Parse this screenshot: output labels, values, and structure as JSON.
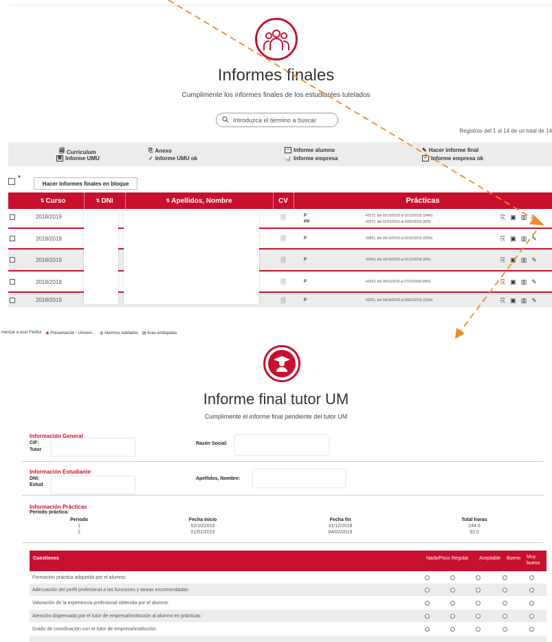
{
  "top": {
    "title": "Informes finales",
    "subtitle": "Cumplimente los informes finales de los estudiantes tutelados",
    "search_placeholder": "Introduzca el término a buscar",
    "records": "Registros del 1 al 14 de un total de 14"
  },
  "legend": {
    "curriculum": "Curriculum",
    "informe_umu": "Informe UMU",
    "anexo": "Anexo",
    "informe_umu_ok": "Informe UMU ok",
    "informe_alumno": "Informe alumno",
    "informe_empresa": "Informe empresa",
    "hacer_informe_final": "Hacer informe final",
    "informe_empresa_ok": "Informe empresa ok"
  },
  "bulk_button": "Hacer informes finales en bloque",
  "table": {
    "headers": {
      "curso": "Curso",
      "dni": "DNI",
      "nombre": "Apellidos, Nombre",
      "cv": "CV",
      "practicas": "Prácticas"
    },
    "rows": [
      {
        "curso": "2018/2019",
        "lines": [
          {
            "type": "P",
            "desc": "43272, del 02/10/2018 al 31/12/2018 (244h)"
          },
          {
            "type": "PR",
            "desc": "43272, del 01/01/2019 al 04/02/2019 (92h)"
          }
        ]
      },
      {
        "curso": "2018/2019",
        "lines": [
          {
            "type": "P",
            "desc": "43851, del 05/12/2018 al 01/02/2019 (205h)"
          }
        ]
      },
      {
        "curso": "2018/2019",
        "lines": [
          {
            "type": "P",
            "desc": "42964, del 10/10/2018 al 31/10/2018 (60h)"
          }
        ]
      },
      {
        "curso": "2018/2019",
        "lines": [
          {
            "type": "P",
            "desc": "42923, del 20/11/2018 al 27/12/2018 (84h)"
          }
        ]
      },
      {
        "curso": "2018/2019",
        "lines": [
          {
            "type": "P",
            "desc": "43301, del 04/10/2018 al 08/01/2019 (150h)"
          }
        ]
      }
    ]
  },
  "browser_bar": {
    "b1": "menzar a usar Firefox",
    "b2": "Presentación - Univers...",
    "b3": "Alumnos tutelados",
    "b4": "ticas embajadas"
  },
  "final": {
    "title": "Informe final tutor UM",
    "subtitle": "Cumplimente el informe final pendiente del tutor UM",
    "info_general": "Información General",
    "cif": "CIF:",
    "tutor": "Tutor",
    "razon_social": "Razón Social:",
    "info_estudiante": "Información Estudiante",
    "dni": "DNI:",
    "estudios": "Estud",
    "apellidos": "Apellidos, Nombre:",
    "info_practicas": "Información Prácticas",
    "periodo_practica": "Periodo práctica:",
    "periodos_headers": {
      "periodo": "Periodo",
      "inicio": "Fecha inicio",
      "fin": "Fecha fin",
      "horas": "Total horas"
    },
    "periodos": [
      {
        "periodo": "1",
        "inicio": "02/10/2018",
        "fin": "31/12/2018",
        "horas": "244.0"
      },
      {
        "periodo": "2",
        "inicio": "01/01/2019",
        "fin": "04/02/2019",
        "horas": "92.0"
      }
    ],
    "cuestiones_header": "Cuestiones",
    "scale": [
      "Nada/Poco",
      "Regular",
      "Aceptable",
      "Bueno",
      "Muy bueno"
    ],
    "questions": [
      "Formación práctica adquirida por el alumno:",
      "Adecuación del perfil profesional a las funciones y tareas encomendadas:",
      "Valoración de la experiencia profesional obtenida por el alumno:",
      "Atención dispensada por el tutor de empresa/institución al alumno en prácticas:",
      "Grado de coordinación con el tutor de empresa/institución:"
    ]
  },
  "colors": {
    "accent": "#c8102e",
    "arrow": "#f08a24"
  }
}
